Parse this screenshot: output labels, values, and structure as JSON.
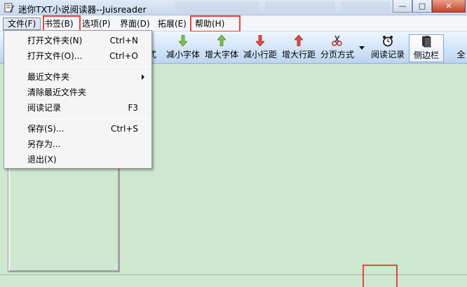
{
  "window": {
    "title": "迷你TXT小说阅读器--Juisreader",
    "controls": {
      "minimize": "—",
      "maximize": "□",
      "close": "✕"
    }
  },
  "menubar": {
    "items": [
      {
        "label": "文件(F)"
      },
      {
        "label": "书签(B)"
      },
      {
        "label": "选项(P)"
      },
      {
        "label": "界面(D)"
      },
      {
        "label": "拓展(E)"
      },
      {
        "label": "帮助(H)"
      }
    ]
  },
  "toolbar": {
    "buttons": [
      {
        "label": "式"
      },
      {
        "label": "减小字体",
        "icon": "arrow-down-green-icon"
      },
      {
        "label": "增大字体",
        "icon": "arrow-up-green-icon"
      },
      {
        "label": "减小行距",
        "icon": "arrow-down-red-icon"
      },
      {
        "label": "增大行距",
        "icon": "arrow-up-red-icon"
      },
      {
        "label": "分页方式",
        "icon": "scissors-icon"
      },
      {
        "label": "阅读记录",
        "icon": "alarm-clock-icon"
      },
      {
        "label": "侧边栏",
        "icon": "book-icon"
      },
      {
        "label": "全"
      }
    ]
  },
  "file_menu": {
    "items": [
      {
        "label": "打开文件夹(N)",
        "shortcut": "Ctrl+N"
      },
      {
        "label": "打开文件(O)...",
        "shortcut": "Ctrl+O"
      },
      {
        "label": "最近文件夹",
        "shortcut": ""
      },
      {
        "label": "清除最近文件夹",
        "shortcut": ""
      },
      {
        "label": "阅读记录",
        "shortcut": "F3"
      },
      {
        "label": "保存(S)...",
        "shortcut": "Ctrl+S"
      },
      {
        "label": "另存为...",
        "shortcut": ""
      },
      {
        "label": "退出(X)",
        "shortcut": ""
      }
    ]
  },
  "colors": {
    "highlight": "#e8463c",
    "content_background": "#cde8cf",
    "toolbar_background": "#cfe3f8"
  }
}
